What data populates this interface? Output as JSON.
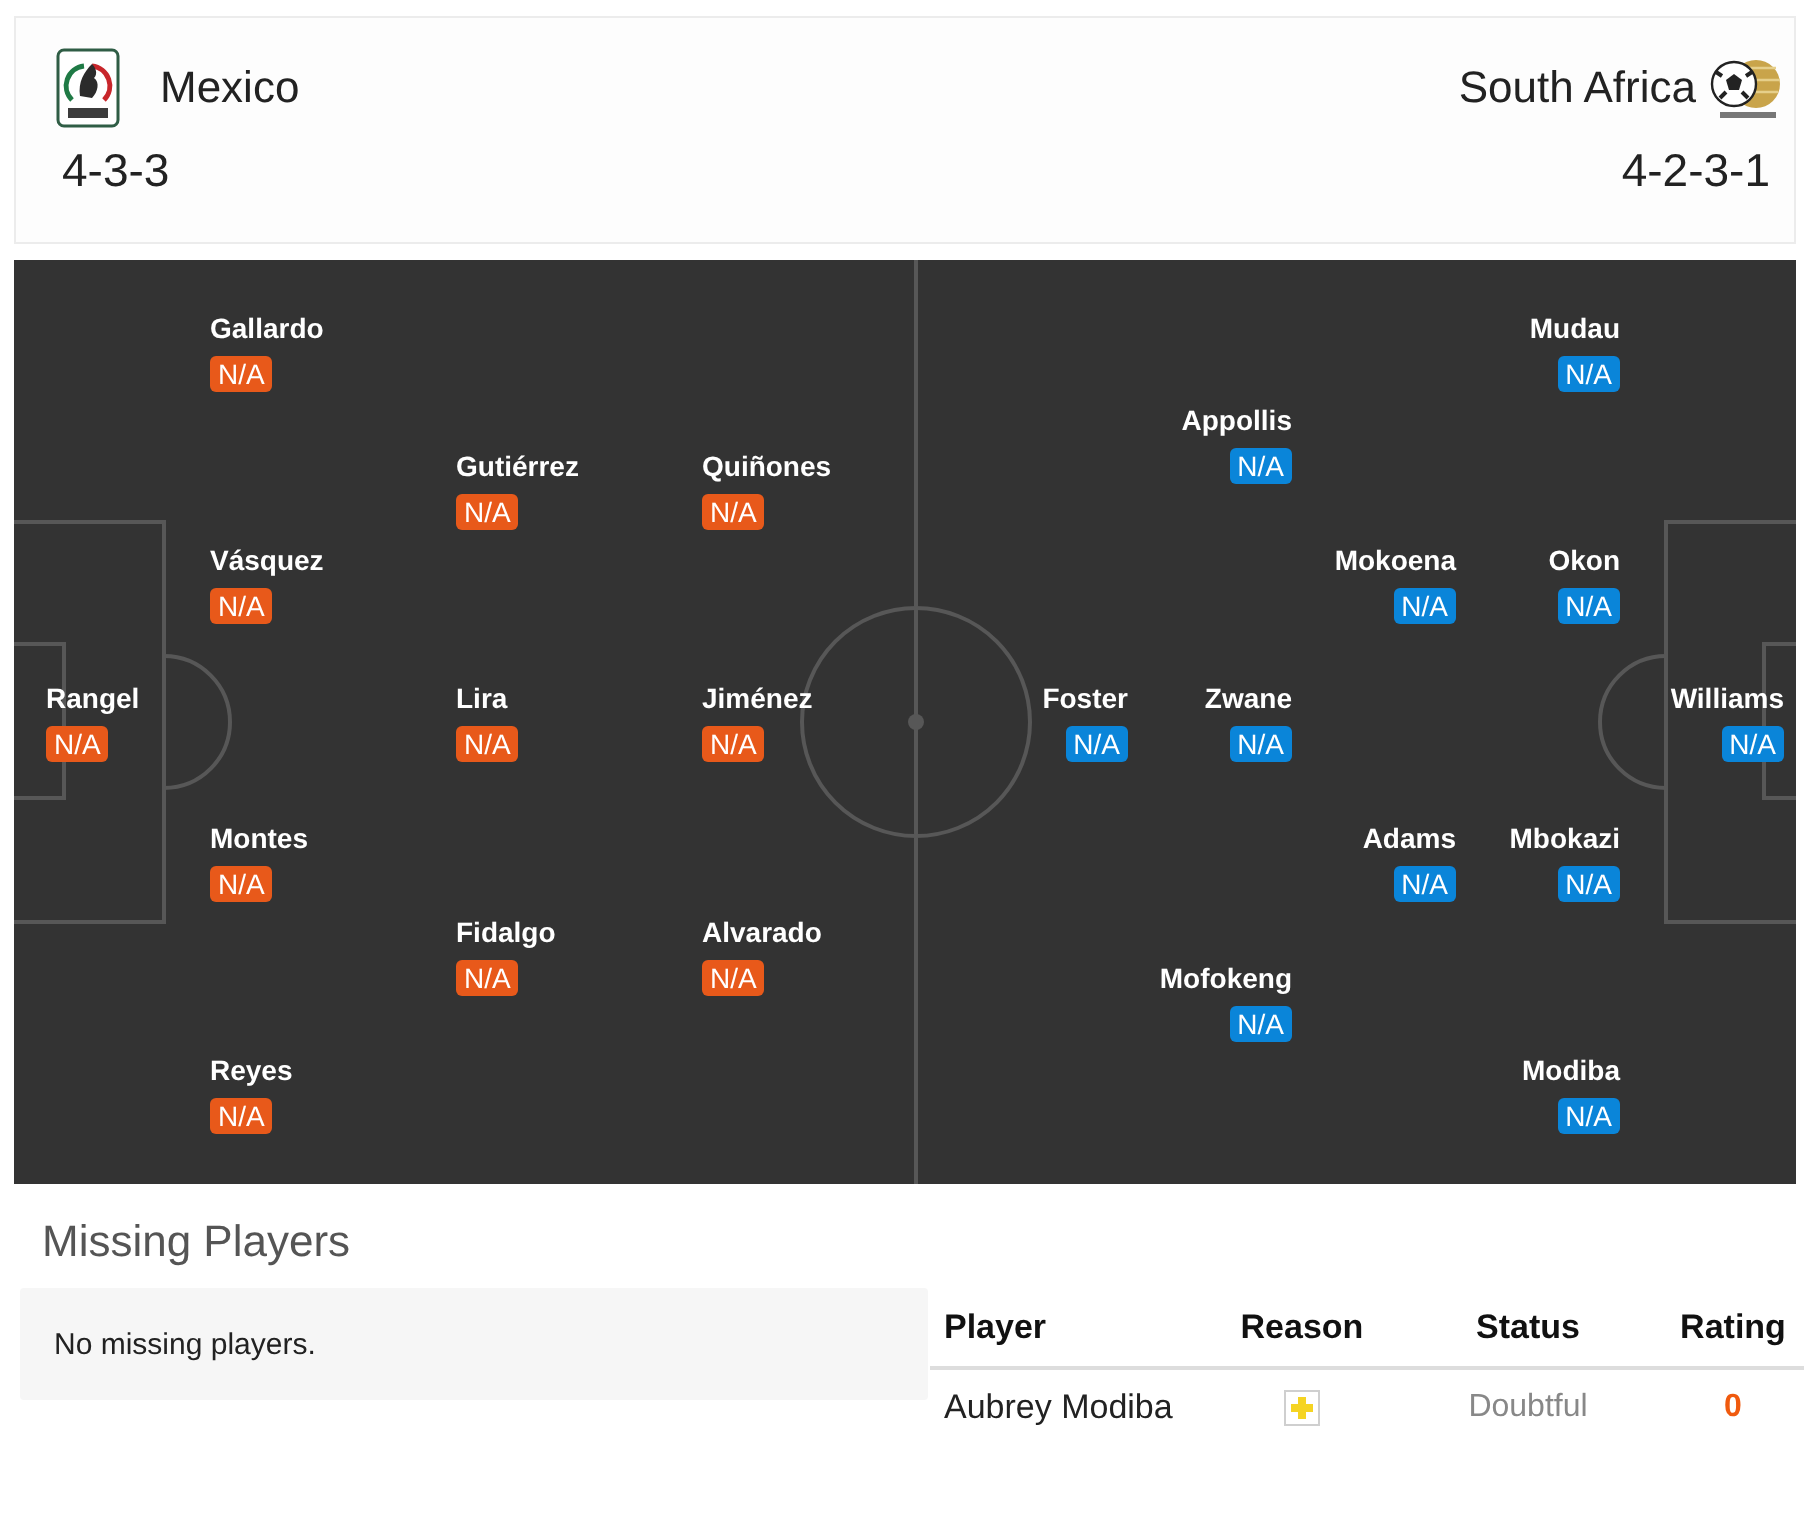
{
  "teams": [
    {
      "name": "Mexico",
      "formation": "4-3-3",
      "color": "#e8591a",
      "lines": [
        [
          {
            "name": "Rangel",
            "rating": "N/A"
          }
        ],
        [
          {
            "name": "Gallardo",
            "rating": "N/A"
          },
          {
            "name": "Vásquez",
            "rating": "N/A"
          },
          {
            "name": "Montes",
            "rating": "N/A"
          },
          {
            "name": "Reyes",
            "rating": "N/A"
          }
        ],
        [
          {
            "name": "Gutiérrez",
            "rating": "N/A"
          },
          {
            "name": "Lira",
            "rating": "N/A"
          },
          {
            "name": "Fidalgo",
            "rating": "N/A"
          }
        ],
        [
          {
            "name": "Quiñones",
            "rating": "N/A"
          },
          {
            "name": "Jiménez",
            "rating": "N/A"
          },
          {
            "name": "Alvarado",
            "rating": "N/A"
          }
        ]
      ]
    },
    {
      "name": "South Africa",
      "formation": "4-2-3-1",
      "color": "#0a85d9",
      "lines": [
        [
          {
            "name": "Foster",
            "rating": "N/A"
          }
        ],
        [
          {
            "name": "Appollis",
            "rating": "N/A"
          },
          {
            "name": "Zwane",
            "rating": "N/A"
          },
          {
            "name": "Mofokeng",
            "rating": "N/A"
          }
        ],
        [
          {
            "name": "Mokoena",
            "rating": "N/A"
          },
          {
            "name": "Adams",
            "rating": "N/A"
          }
        ],
        [
          {
            "name": "Mudau",
            "rating": "N/A"
          },
          {
            "name": "Okon",
            "rating": "N/A"
          },
          {
            "name": "Mbokazi",
            "rating": "N/A"
          },
          {
            "name": "Modiba",
            "rating": "N/A"
          }
        ],
        [
          {
            "name": "Williams",
            "rating": "N/A"
          }
        ]
      ]
    }
  ],
  "missing_players": {
    "title": "Missing Players",
    "teams": [
      {
        "kind": "message",
        "text": "No missing players."
      },
      {
        "kind": "table",
        "columns": [
          "Player",
          "Reason",
          "Status",
          "Rating"
        ],
        "rows": [
          {
            "player": "Aubrey Modiba",
            "status": "Doubtful",
            "rating": "0"
          }
        ]
      }
    ]
  }
}
